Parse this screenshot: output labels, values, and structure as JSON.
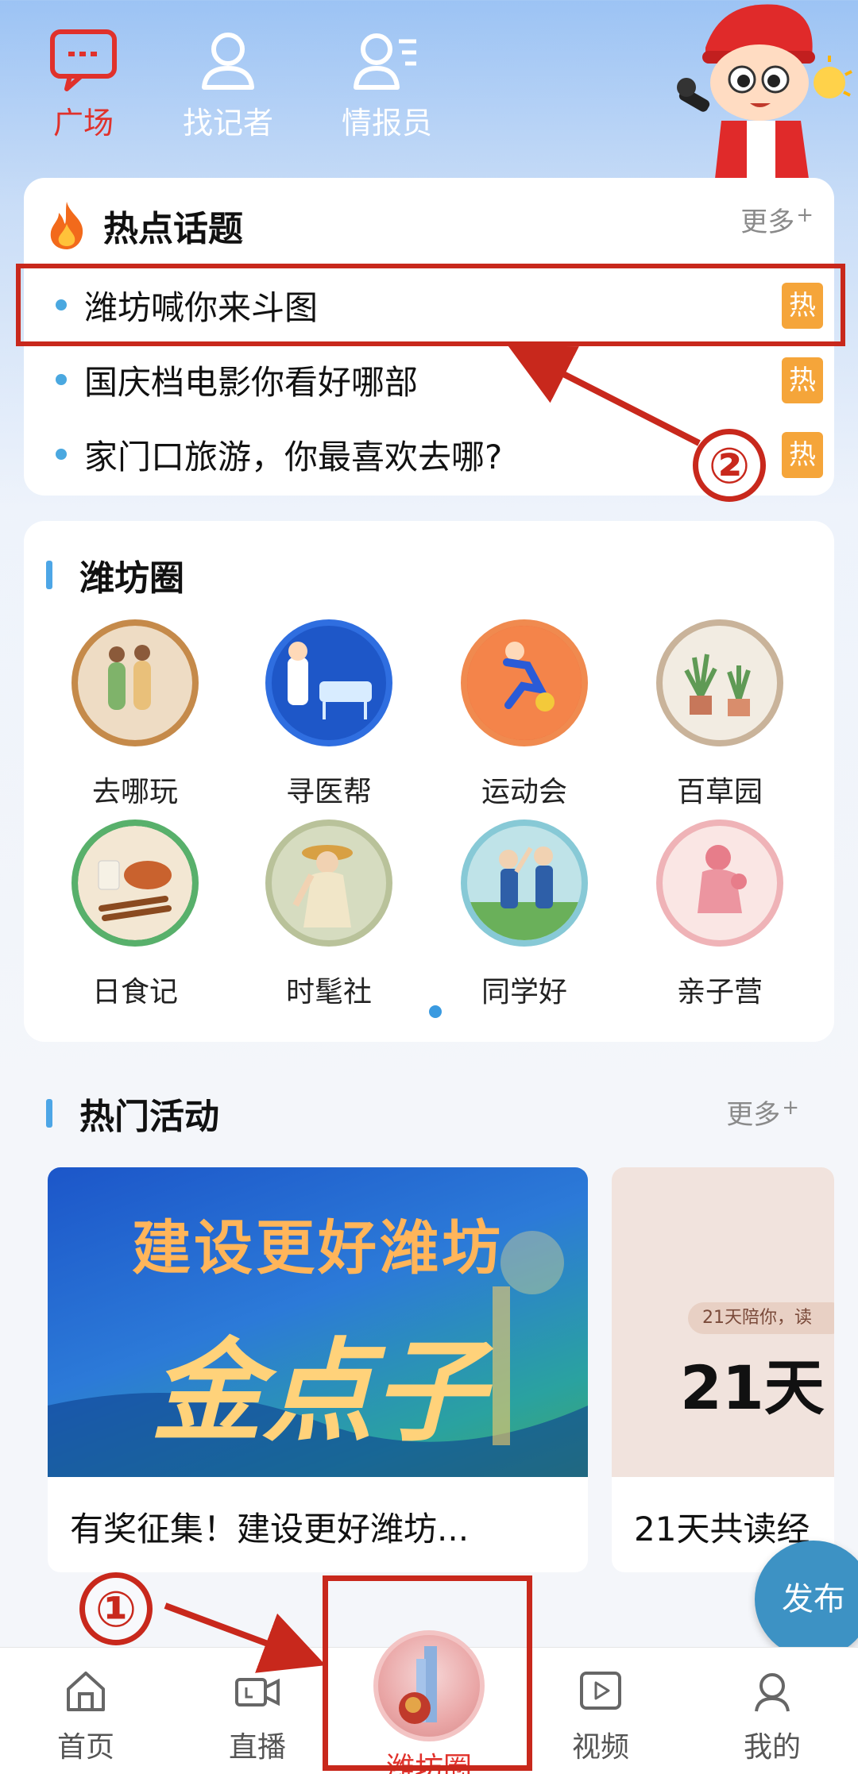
{
  "top_nav": {
    "items": [
      {
        "label": "广场",
        "icon": "chat-bubble-icon",
        "active": true
      },
      {
        "label": "找记者",
        "icon": "person-icon",
        "active": false
      },
      {
        "label": "情报员",
        "icon": "person-list-icon",
        "active": false
      }
    ]
  },
  "hot_topics": {
    "title": "热点话题",
    "more": "更多",
    "more_sup": "+",
    "items": [
      {
        "text": "潍坊喊你来斗图",
        "badge": "热"
      },
      {
        "text": "国庆档电影你看好哪部",
        "badge": "热"
      },
      {
        "text": "家门口旅游，你最喜欢去哪?",
        "badge": "热"
      }
    ]
  },
  "weifang_circle": {
    "title": "潍坊圈",
    "items": [
      {
        "label": "去哪玩"
      },
      {
        "label": "寻医帮"
      },
      {
        "label": "运动会"
      },
      {
        "label": "百草园"
      },
      {
        "label": "日食记"
      },
      {
        "label": "时髦社"
      },
      {
        "label": "同学好"
      },
      {
        "label": "亲子营"
      }
    ]
  },
  "hot_activities": {
    "title": "热门活动",
    "more": "更多",
    "more_sup": "+",
    "cards": [
      {
        "banner_line1": "建设更好潍坊",
        "banner_line2": "金点子",
        "caption": "有奖征集！建设更好潍坊..."
      },
      {
        "banner_small": "21天陪你，读",
        "banner_big": "21天",
        "caption": "21天共读经"
      }
    ]
  },
  "publish_button": "发布",
  "tabbar": {
    "items": [
      {
        "label": "首页",
        "icon": "home-icon"
      },
      {
        "label": "直播",
        "icon": "video-camera-icon"
      },
      {
        "label": "潍坊圈",
        "icon": "weifang-circle-logo-icon",
        "active": true
      },
      {
        "label": "视频",
        "icon": "play-video-icon"
      },
      {
        "label": "我的",
        "icon": "user-profile-icon"
      }
    ]
  },
  "annotations": {
    "step1": "①",
    "step2": "②"
  },
  "colors": {
    "accent_red": "#e0312b",
    "annotation_red": "#c8281c",
    "hot_badge": "#f5a53a",
    "bullet_blue": "#4aa8e0",
    "publish_blue": "#3d92c4"
  }
}
